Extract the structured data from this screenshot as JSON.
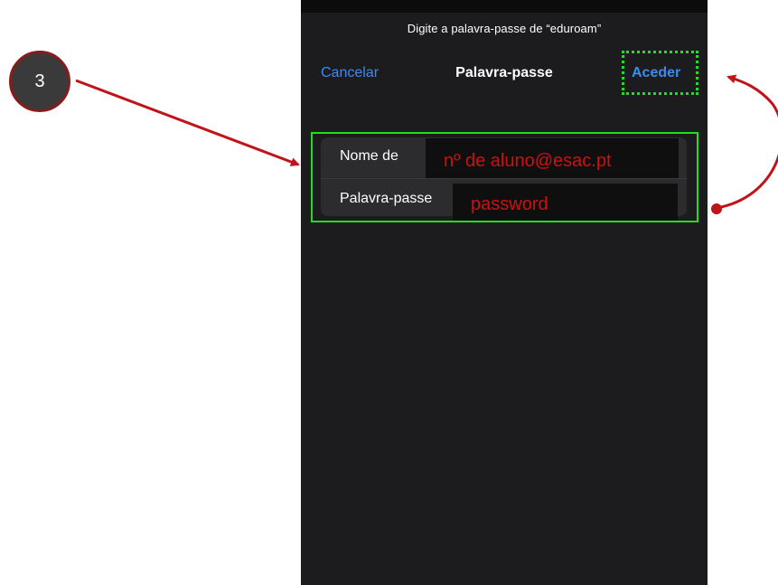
{
  "dialog": {
    "prompt": "Digite a palavra-passe de “eduroam”",
    "title": "Palavra-passe",
    "cancel_label": "Cancelar",
    "join_label": "Aceder"
  },
  "form": {
    "username_label": "Nome de",
    "username_value": "nº de aluno@esac.pt",
    "password_label": "Palavra-passe",
    "password_value": "password"
  },
  "annotation": {
    "step_number": "3"
  },
  "colors": {
    "accent": "#3b8cf0",
    "highlight": "#22dd22",
    "annotation_red": "#c0141a",
    "field_text": "#d10f0f",
    "sheet_bg": "#1c1c1e"
  }
}
